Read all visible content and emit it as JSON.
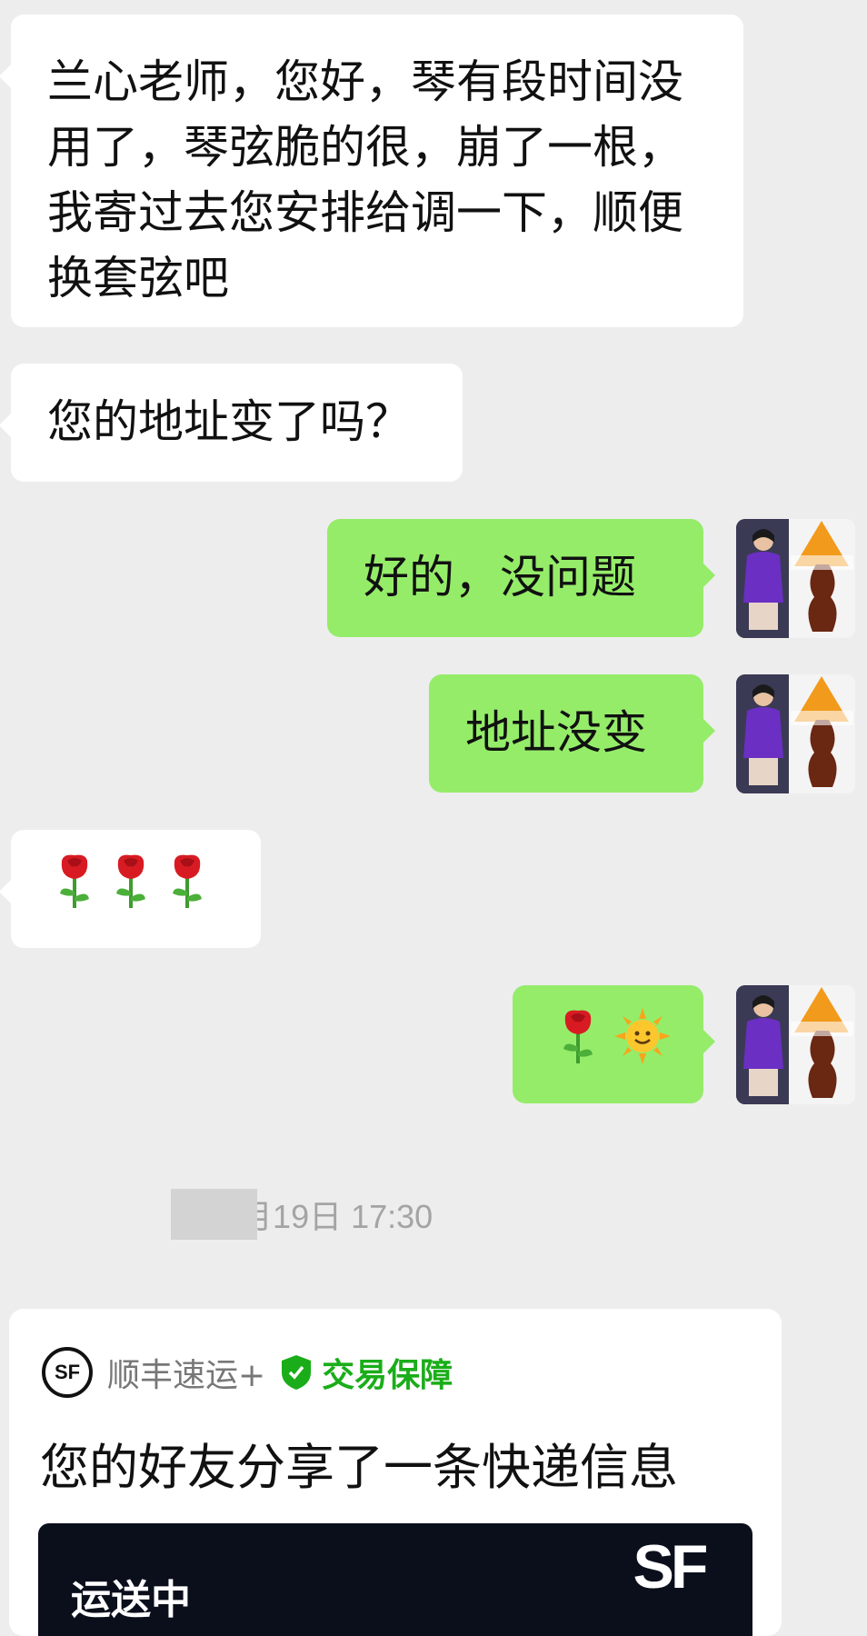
{
  "messages": [
    {
      "side": "in",
      "text": "兰心老师，您好，琴有段时间没用了，琴弦脆的很，崩了一根，我寄过去您安排给调一下，顺便换套弦吧"
    },
    {
      "side": "in",
      "text": "您的地址变了吗？"
    },
    {
      "side": "out",
      "text": "好的，没问题"
    },
    {
      "side": "out",
      "text": "地址没变"
    },
    {
      "side": "in",
      "emoji": [
        "rose",
        "rose",
        "rose"
      ],
      "text": "🌹🌹🌹"
    },
    {
      "side": "out",
      "emoji": [
        "rose",
        "sun-with-face"
      ],
      "text": "🌹🌞"
    }
  ],
  "timestamp": "5年4月19日 17:30",
  "shared_card": {
    "service": "顺丰速运+",
    "badge": "交易保障",
    "title": "您的好友分享了一条快递信息",
    "status": "运送中",
    "logo_text": "SF"
  },
  "colors": {
    "background": "#ededed",
    "incoming_bubble": "#ffffff",
    "outgoing_bubble": "#95ec69",
    "guarantee_green": "#1aad19",
    "banner_dark": "#0b0f1c"
  }
}
